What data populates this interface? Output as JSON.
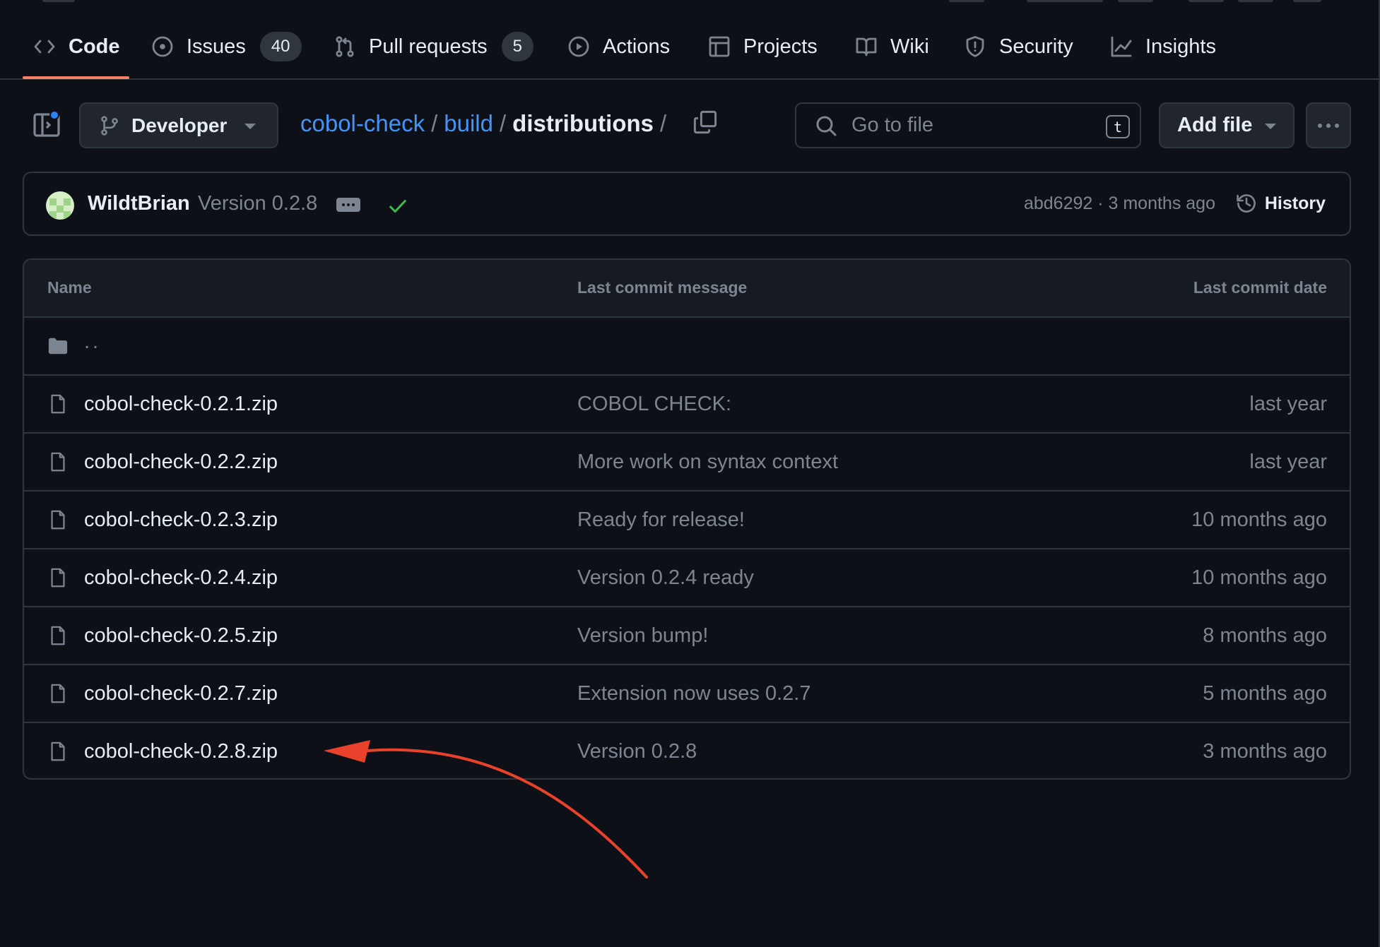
{
  "repo_nav": {
    "items": [
      {
        "label": "Code",
        "active": true,
        "icon": "code-icon"
      },
      {
        "label": "Issues",
        "count": "40",
        "icon": "issue-icon"
      },
      {
        "label": "Pull requests",
        "count": "5",
        "icon": "pull-request-icon"
      },
      {
        "label": "Actions",
        "icon": "play-icon"
      },
      {
        "label": "Projects",
        "icon": "table-icon"
      },
      {
        "label": "Wiki",
        "icon": "book-icon"
      },
      {
        "label": "Security",
        "icon": "shield-icon"
      },
      {
        "label": "Insights",
        "icon": "graph-icon"
      }
    ]
  },
  "toolbar": {
    "branch": "Developer",
    "breadcrumb": {
      "repo": "cobol-check",
      "dir1": "build",
      "current": "distributions",
      "trailing_sep": "/",
      "sep": "/"
    },
    "search_placeholder": "Go to file",
    "search_shortcut": "t",
    "add_file_label": "Add file"
  },
  "latest_commit": {
    "author": "WildtBrian",
    "message": "Version 0.2.8",
    "status": "success",
    "sha_time": "abd6292 · 3 months ago",
    "history_label": "History"
  },
  "file_table": {
    "headers": {
      "name": "Name",
      "message": "Last commit message",
      "date": "Last commit date"
    },
    "parent_dir": "..",
    "rows": [
      {
        "name": "cobol-check-0.2.1.zip",
        "message": "COBOL CHECK:",
        "date": "last year"
      },
      {
        "name": "cobol-check-0.2.2.zip",
        "message": "More work on syntax context",
        "date": "last year"
      },
      {
        "name": "cobol-check-0.2.3.zip",
        "message": "Ready for release!",
        "date": "10 months ago"
      },
      {
        "name": "cobol-check-0.2.4.zip",
        "message": "Version 0.2.4 ready",
        "date": "10 months ago"
      },
      {
        "name": "cobol-check-0.2.5.zip",
        "message": "Version bump!",
        "date": "8 months ago"
      },
      {
        "name": "cobol-check-0.2.7.zip",
        "message": "Extension now uses 0.2.7",
        "date": "5 months ago"
      },
      {
        "name": "cobol-check-0.2.8.zip",
        "message": "Version 0.2.8",
        "date": "3 months ago"
      }
    ]
  },
  "colors": {
    "background": "#0d1117",
    "border": "#30363d",
    "link": "#4493f8",
    "active_underline": "#f78166",
    "success": "#3fb950",
    "annotation_arrow": "#e8412c"
  }
}
